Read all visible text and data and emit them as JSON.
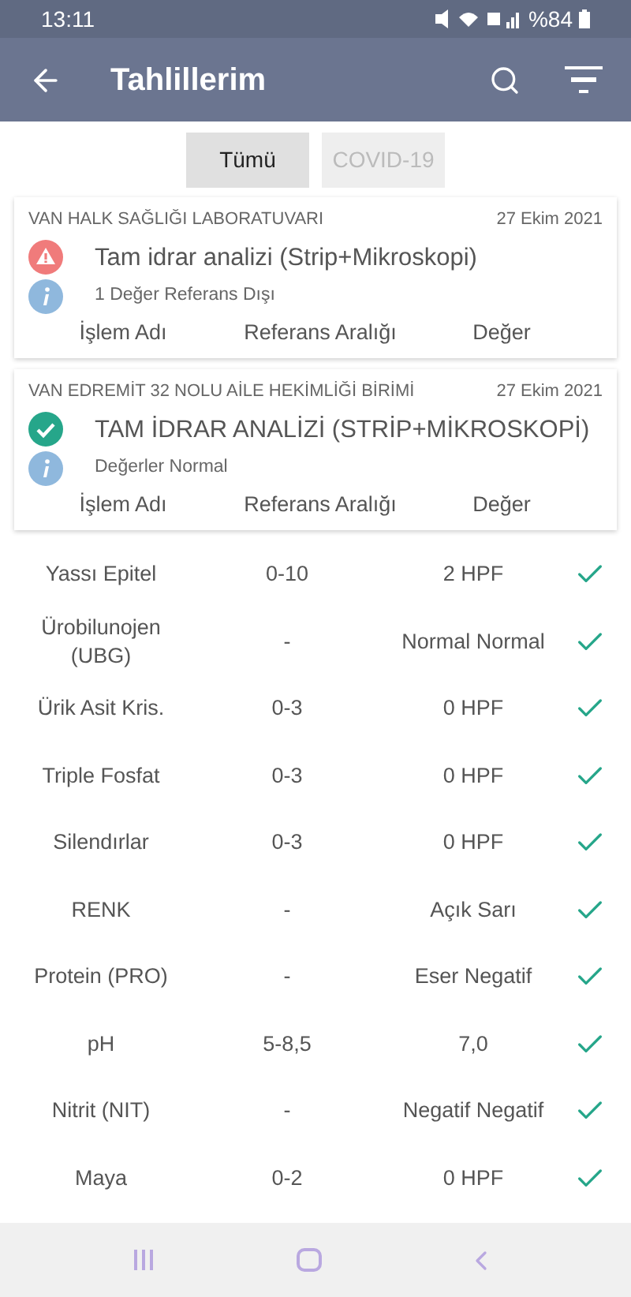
{
  "status_bar": {
    "time": "13:11",
    "battery": "%84"
  },
  "app_bar": {
    "title": "Tahlillerim"
  },
  "tabs": [
    {
      "label": "Tümü",
      "selected": true
    },
    {
      "label": "COVID-19",
      "selected": false
    }
  ],
  "cards": [
    {
      "lab": "VAN HALK SAĞLIĞI LABORATUVARI",
      "date": "27 Ekim 2021",
      "out_of_range": true,
      "test": "Tam idrar analizi (Strip+Mikroskopi)",
      "info": "1 Değer Referans Dışı",
      "columns": [
        "İşlem Adı",
        "Referans Aralığı",
        "Değer"
      ]
    },
    {
      "lab": "VAN EDREMİT 32 NOLU AİLE HEKİMLİĞİ BİRİMİ",
      "date": "27 Ekim 2021",
      "out_of_range": false,
      "test": "TAM İDRAR ANALİZİ (STRİP+MİKROSKOPİ)",
      "info": "Değerler Normal",
      "columns": [
        "İşlem Adı",
        "Referans Aralığı",
        "Değer"
      ]
    }
  ],
  "results": [
    {
      "name": "Yassı Epitel",
      "range": "0-10",
      "value": "2 HPF",
      "normal": true
    },
    {
      "name": "Ürobilunojen (UBG)",
      "range": "-",
      "value": "Normal Normal",
      "normal": true
    },
    {
      "name": "Ürik Asit Kris.",
      "range": "0-3",
      "value": "0 HPF",
      "normal": true
    },
    {
      "name": "Triple Fosfat",
      "range": "0-3",
      "value": "0 HPF",
      "normal": true
    },
    {
      "name": "Silendırlar",
      "range": "0-3",
      "value": "0 HPF",
      "normal": true
    },
    {
      "name": "RENK",
      "range": "-",
      "value": "Açık Sarı",
      "normal": true
    },
    {
      "name": "Protein (PRO)",
      "range": "-",
      "value": "Eser Negatif",
      "normal": true
    },
    {
      "name": "pH",
      "range": "5-8,5",
      "value": "7,0",
      "normal": true
    },
    {
      "name": "Nitrit (NIT)",
      "range": "-",
      "value": "Negatif Negatif",
      "normal": true
    },
    {
      "name": "Maya",
      "range": "0-2",
      "value": "0 HPF",
      "normal": true
    }
  ]
}
